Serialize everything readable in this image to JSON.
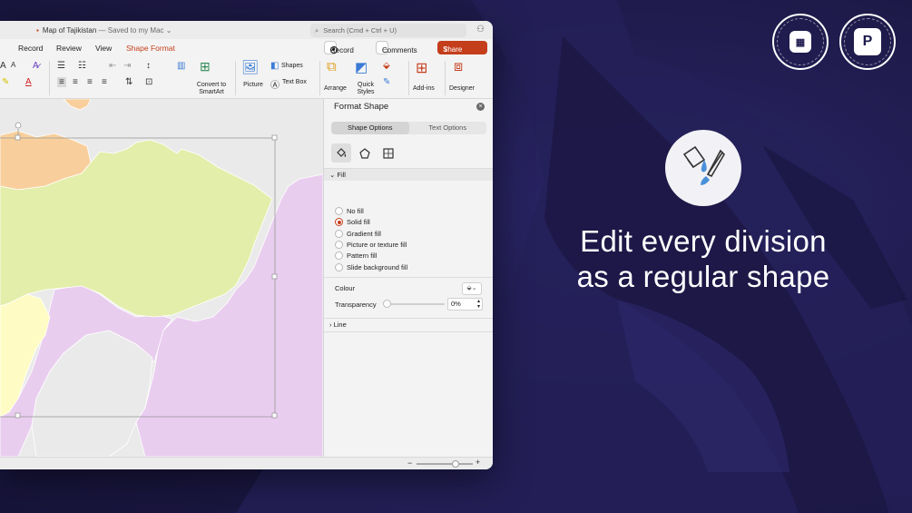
{
  "window": {
    "doc_title": "Map of Tajikistan",
    "saved_status": "— Saved to my Mac",
    "search_placeholder": "Search (Cmd + Ctrl + U)"
  },
  "tabs": [
    "Record",
    "Review",
    "View",
    "Shape Format"
  ],
  "actions": {
    "record": "Record",
    "comments": "Comments",
    "share": "Share"
  },
  "ribbon": {
    "convert_smartart": [
      "Convert to",
      "SmartArt"
    ],
    "picture": "Picture",
    "shapes": "Shapes",
    "text_box": "Text Box",
    "arrange": "Arrange",
    "quick_styles": [
      "Quick",
      "Styles"
    ],
    "addins": "Add-ins",
    "designer": "Designer"
  },
  "pane": {
    "title": "Format Shape",
    "tab_shape_options": "Shape Options",
    "tab_text_options": "Text Options",
    "fill_header": "Fill",
    "fill_options": [
      "No fill",
      "Solid fill",
      "Gradient fill",
      "Picture or texture fill",
      "Pattern fill",
      "Slide background fill"
    ],
    "selected_fill": "Solid fill",
    "colour_label": "Colour",
    "transparency_label": "Transparency",
    "transparency_value": "0%",
    "line_header": "Line"
  },
  "promo": {
    "line1": "Edit every division",
    "line2": "as a regular shape"
  },
  "badges": {
    "badge1_text": "PPTXMAN · COM · PPTXMAN · COM ·",
    "badge2_text": "100 % · POWERPOINT · EDITABLE ·",
    "badge2_letter": "P"
  },
  "colors": {
    "accent": "#c43e1c",
    "background": "#1e1a4d",
    "map_green": "#e3eeaa",
    "map_purple": "#e9cdef",
    "map_orange": "#f8cf9c",
    "map_yellow": "#fefcc4",
    "map_gray": "#eaeaea"
  },
  "icons": [
    "search-icon",
    "share-person-icon",
    "fill-bucket-icon",
    "paint-brush-icon",
    "pentagon-icon",
    "size-properties-icon",
    "close-icon"
  ]
}
